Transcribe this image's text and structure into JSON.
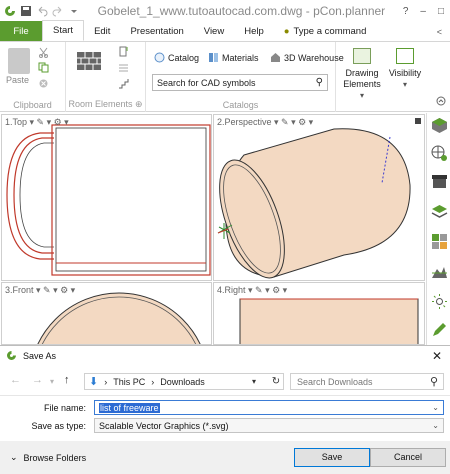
{
  "titlebar": {
    "title": "Gobelet_1_www.tutoautocad.com.dwg - pCon.planner",
    "help": "?",
    "minimize": "–",
    "restore": "□"
  },
  "tabs": {
    "file": "File",
    "start": "Start",
    "edit": "Edit",
    "presentation": "Presentation",
    "view": "View",
    "help": "Help",
    "tell_me": "Type a command"
  },
  "ribbon": {
    "paste": "Paste",
    "groups": {
      "clipboard": "Clipboard",
      "room_elements": "Room Elements",
      "catalogs": "Catalogs"
    },
    "catalog": "Catalog",
    "materials": "Materials",
    "warehouse": "3D Warehouse",
    "search_placeholder": "Search for CAD symbols",
    "drawing_elements_line1": "Drawing",
    "drawing_elements_line2": "Elements",
    "visibility": "Visibility"
  },
  "viewports": {
    "top": "1.Top",
    "perspective": "2.Perspective",
    "front": "3.Front",
    "right": "4.Right"
  },
  "dialog": {
    "title": "Save As",
    "path_pc": "This PC",
    "path_folder": "Downloads",
    "search_placeholder": "Search Downloads",
    "file_name_label": "File name:",
    "file_name_value": "list of freeware",
    "save_type_label": "Save as type:",
    "save_type_value": "Scalable Vector Graphics (*.svg)",
    "browse_folders": "Browse Folders",
    "save": "Save",
    "cancel": "Cancel"
  },
  "colors": {
    "accent_green": "#5b9c2f",
    "object_fill": "#f3d9c2",
    "mug_red": "#c0392b",
    "selection_blue": "#2d6bd3"
  }
}
